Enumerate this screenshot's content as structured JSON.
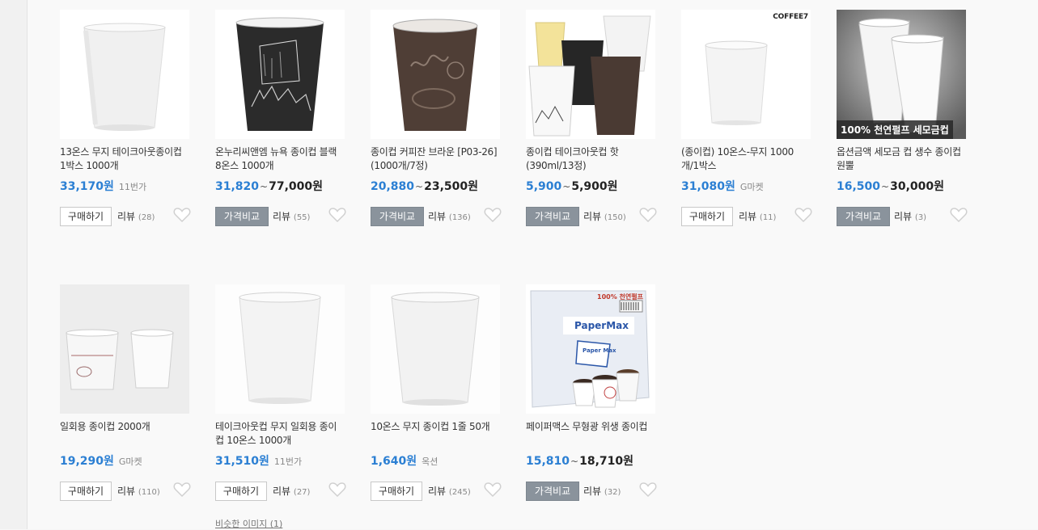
{
  "products": [
    {
      "title": "13온스 무지 테이크아웃종이컵 1박스 1000개",
      "price": "33,170원",
      "price_max": "",
      "seller": "11번가",
      "action_label": "구매하기",
      "action_type": "buy",
      "review_label": "리뷰",
      "review_count": "(28)",
      "badge": "",
      "logo": ""
    },
    {
      "title": "온누리씨앤엠 뉴욕 종이컵 블랙 8온스 1000개",
      "price": "31,820",
      "price_max": "77,000원",
      "seller": "",
      "action_label": "가격비교",
      "action_type": "compare",
      "review_label": "리뷰",
      "review_count": "(55)",
      "badge": "",
      "logo": ""
    },
    {
      "title": "종이컵 커피잔 브라운 [P03-26] (1000개/7정)",
      "price": "20,880",
      "price_max": "23,500원",
      "seller": "",
      "action_label": "가격비교",
      "action_type": "compare",
      "review_label": "리뷰",
      "review_count": "(136)",
      "badge": "",
      "logo": ""
    },
    {
      "title": "종이컵 테이크아웃컵 핫 (390ml/13정)",
      "price": "5,900",
      "price_max": "5,900원",
      "seller": "",
      "action_label": "가격비교",
      "action_type": "compare",
      "review_label": "리뷰",
      "review_count": "(150)",
      "badge": "",
      "logo": ""
    },
    {
      "title": "(종이컵) 10온스-무지 1000개/1박스",
      "price": "31,080원",
      "price_max": "",
      "seller": "G마켓",
      "action_label": "구매하기",
      "action_type": "buy",
      "review_label": "리뷰",
      "review_count": "(11)",
      "badge": "",
      "logo": "COFFEE7"
    },
    {
      "title": "옵션금액 세모금 컵 생수 종이컵 원뿔",
      "price": "16,500",
      "price_max": "30,000원",
      "seller": "",
      "action_label": "가격비교",
      "action_type": "compare",
      "review_label": "리뷰",
      "review_count": "(3)",
      "badge": "100% 천연펄프 세모금컵",
      "logo": ""
    },
    {
      "title": "일회용 종이컵 2000개",
      "price": "19,290원",
      "price_max": "",
      "seller": "G마켓",
      "action_label": "구매하기",
      "action_type": "buy",
      "review_label": "리뷰",
      "review_count": "(110)",
      "badge": "",
      "logo": ""
    },
    {
      "title": "테이크아웃컵 무지 일회용 종이컵 10온스 1000개",
      "price": "31,510원",
      "price_max": "",
      "seller": "11번가",
      "action_label": "구매하기",
      "action_type": "buy",
      "review_label": "리뷰",
      "review_count": "(27)",
      "badge": "",
      "logo": "",
      "similar": "비슷한 이미지 (1)"
    },
    {
      "title": "10온스 무지 종이컵 1줄 50개",
      "price": "1,640원",
      "price_max": "",
      "seller": "옥션",
      "action_label": "구매하기",
      "action_type": "buy",
      "review_label": "리뷰",
      "review_count": "(245)",
      "badge": "",
      "logo": ""
    },
    {
      "title": "페이퍼맥스 무형광 위생 종이컵",
      "price": "15,810",
      "price_max": "18,710원",
      "seller": "",
      "action_label": "가격비교",
      "action_type": "compare",
      "review_label": "리뷰",
      "review_count": "(32)",
      "badge": "",
      "logo": "",
      "box_text": [
        "100% 천연펄프",
        "PaperMax",
        "Paper Max"
      ]
    }
  ],
  "icons": {
    "heart": "heart-outline-icon"
  },
  "colors": {
    "price_blue": "#2b7fd3",
    "compare_button": "#8a939c"
  }
}
